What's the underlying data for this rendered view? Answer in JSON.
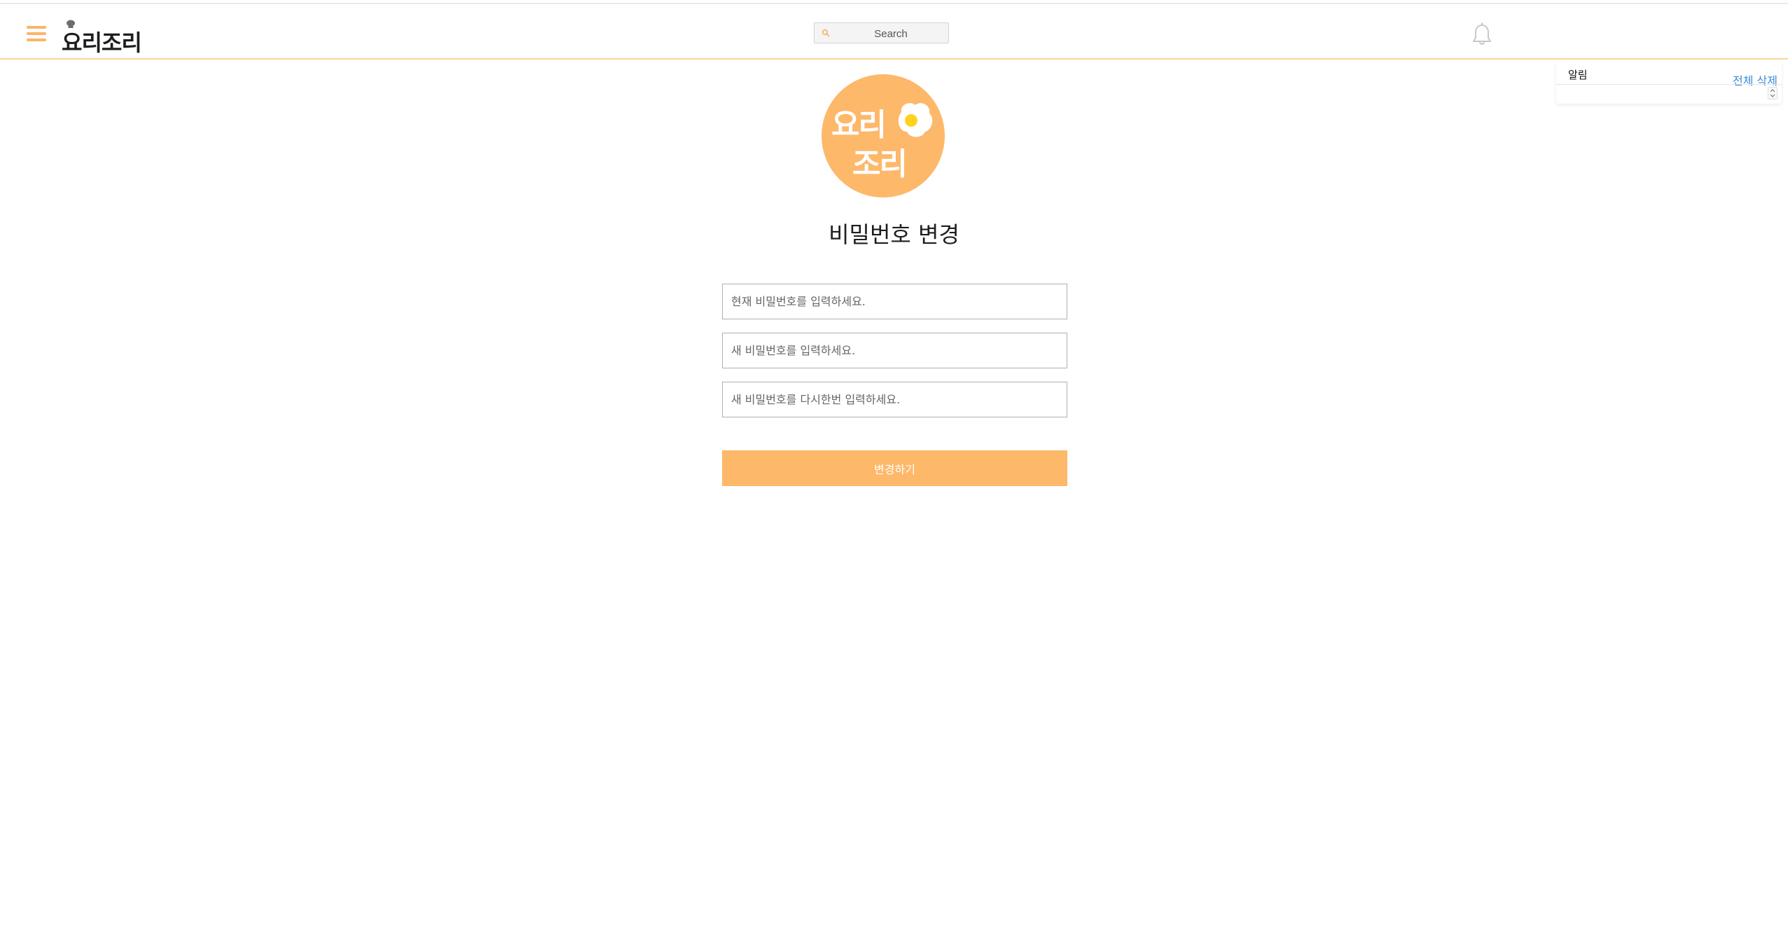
{
  "header": {
    "brand": "요리조리",
    "search_placeholder": "Search"
  },
  "notifications": {
    "title": "알림",
    "clear_all": "전체 삭제"
  },
  "logo": {
    "line1": "요리",
    "line2": "조리"
  },
  "page": {
    "title": "비밀번호 변경"
  },
  "form": {
    "current_password_placeholder": "현재 비밀번호를 입력하세요.",
    "new_password_placeholder": "새 비밀번호를 입력하세요.",
    "confirm_password_placeholder": "새 비밀번호를 다시한번 입력하세요.",
    "submit_label": "변경하기"
  },
  "colors": {
    "accent": "#fdb86a",
    "navbar_border": "#fbd49a",
    "link": "#3d8bd9"
  }
}
